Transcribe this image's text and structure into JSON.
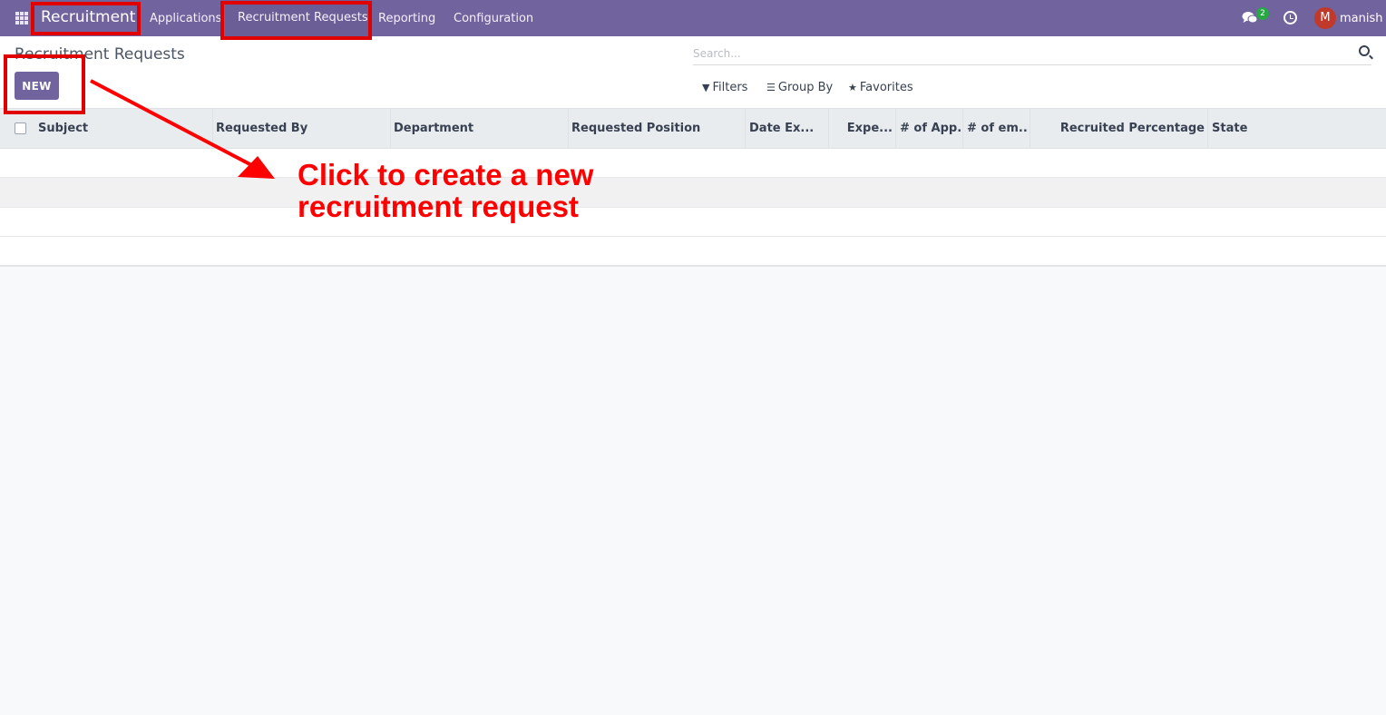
{
  "navbar": {
    "brand": "Recruitment",
    "menu": [
      "Applications",
      "Recruitment Requests",
      "Reporting",
      "Configuration"
    ],
    "notification_count": "2",
    "avatar_letter": "M",
    "username": "manish"
  },
  "control": {
    "title": "Recruitment Requests",
    "new_label": "NEW",
    "search_placeholder": "Search...",
    "filters_label": "Filters",
    "groupby_label": "Group By",
    "favorites_label": "Favorites"
  },
  "table": {
    "columns": [
      "Subject",
      "Requested By",
      "Department",
      "Requested Position",
      "Date Ex...",
      "Expe...",
      "# of App...",
      "# of em...",
      "Recruited Percentage",
      "State"
    ]
  },
  "annotation": {
    "text": "Click to create a new\nrecruitment request",
    "color": "#ff0000"
  },
  "colors": {
    "navbar": "#71639e",
    "accent": "#71639e"
  }
}
